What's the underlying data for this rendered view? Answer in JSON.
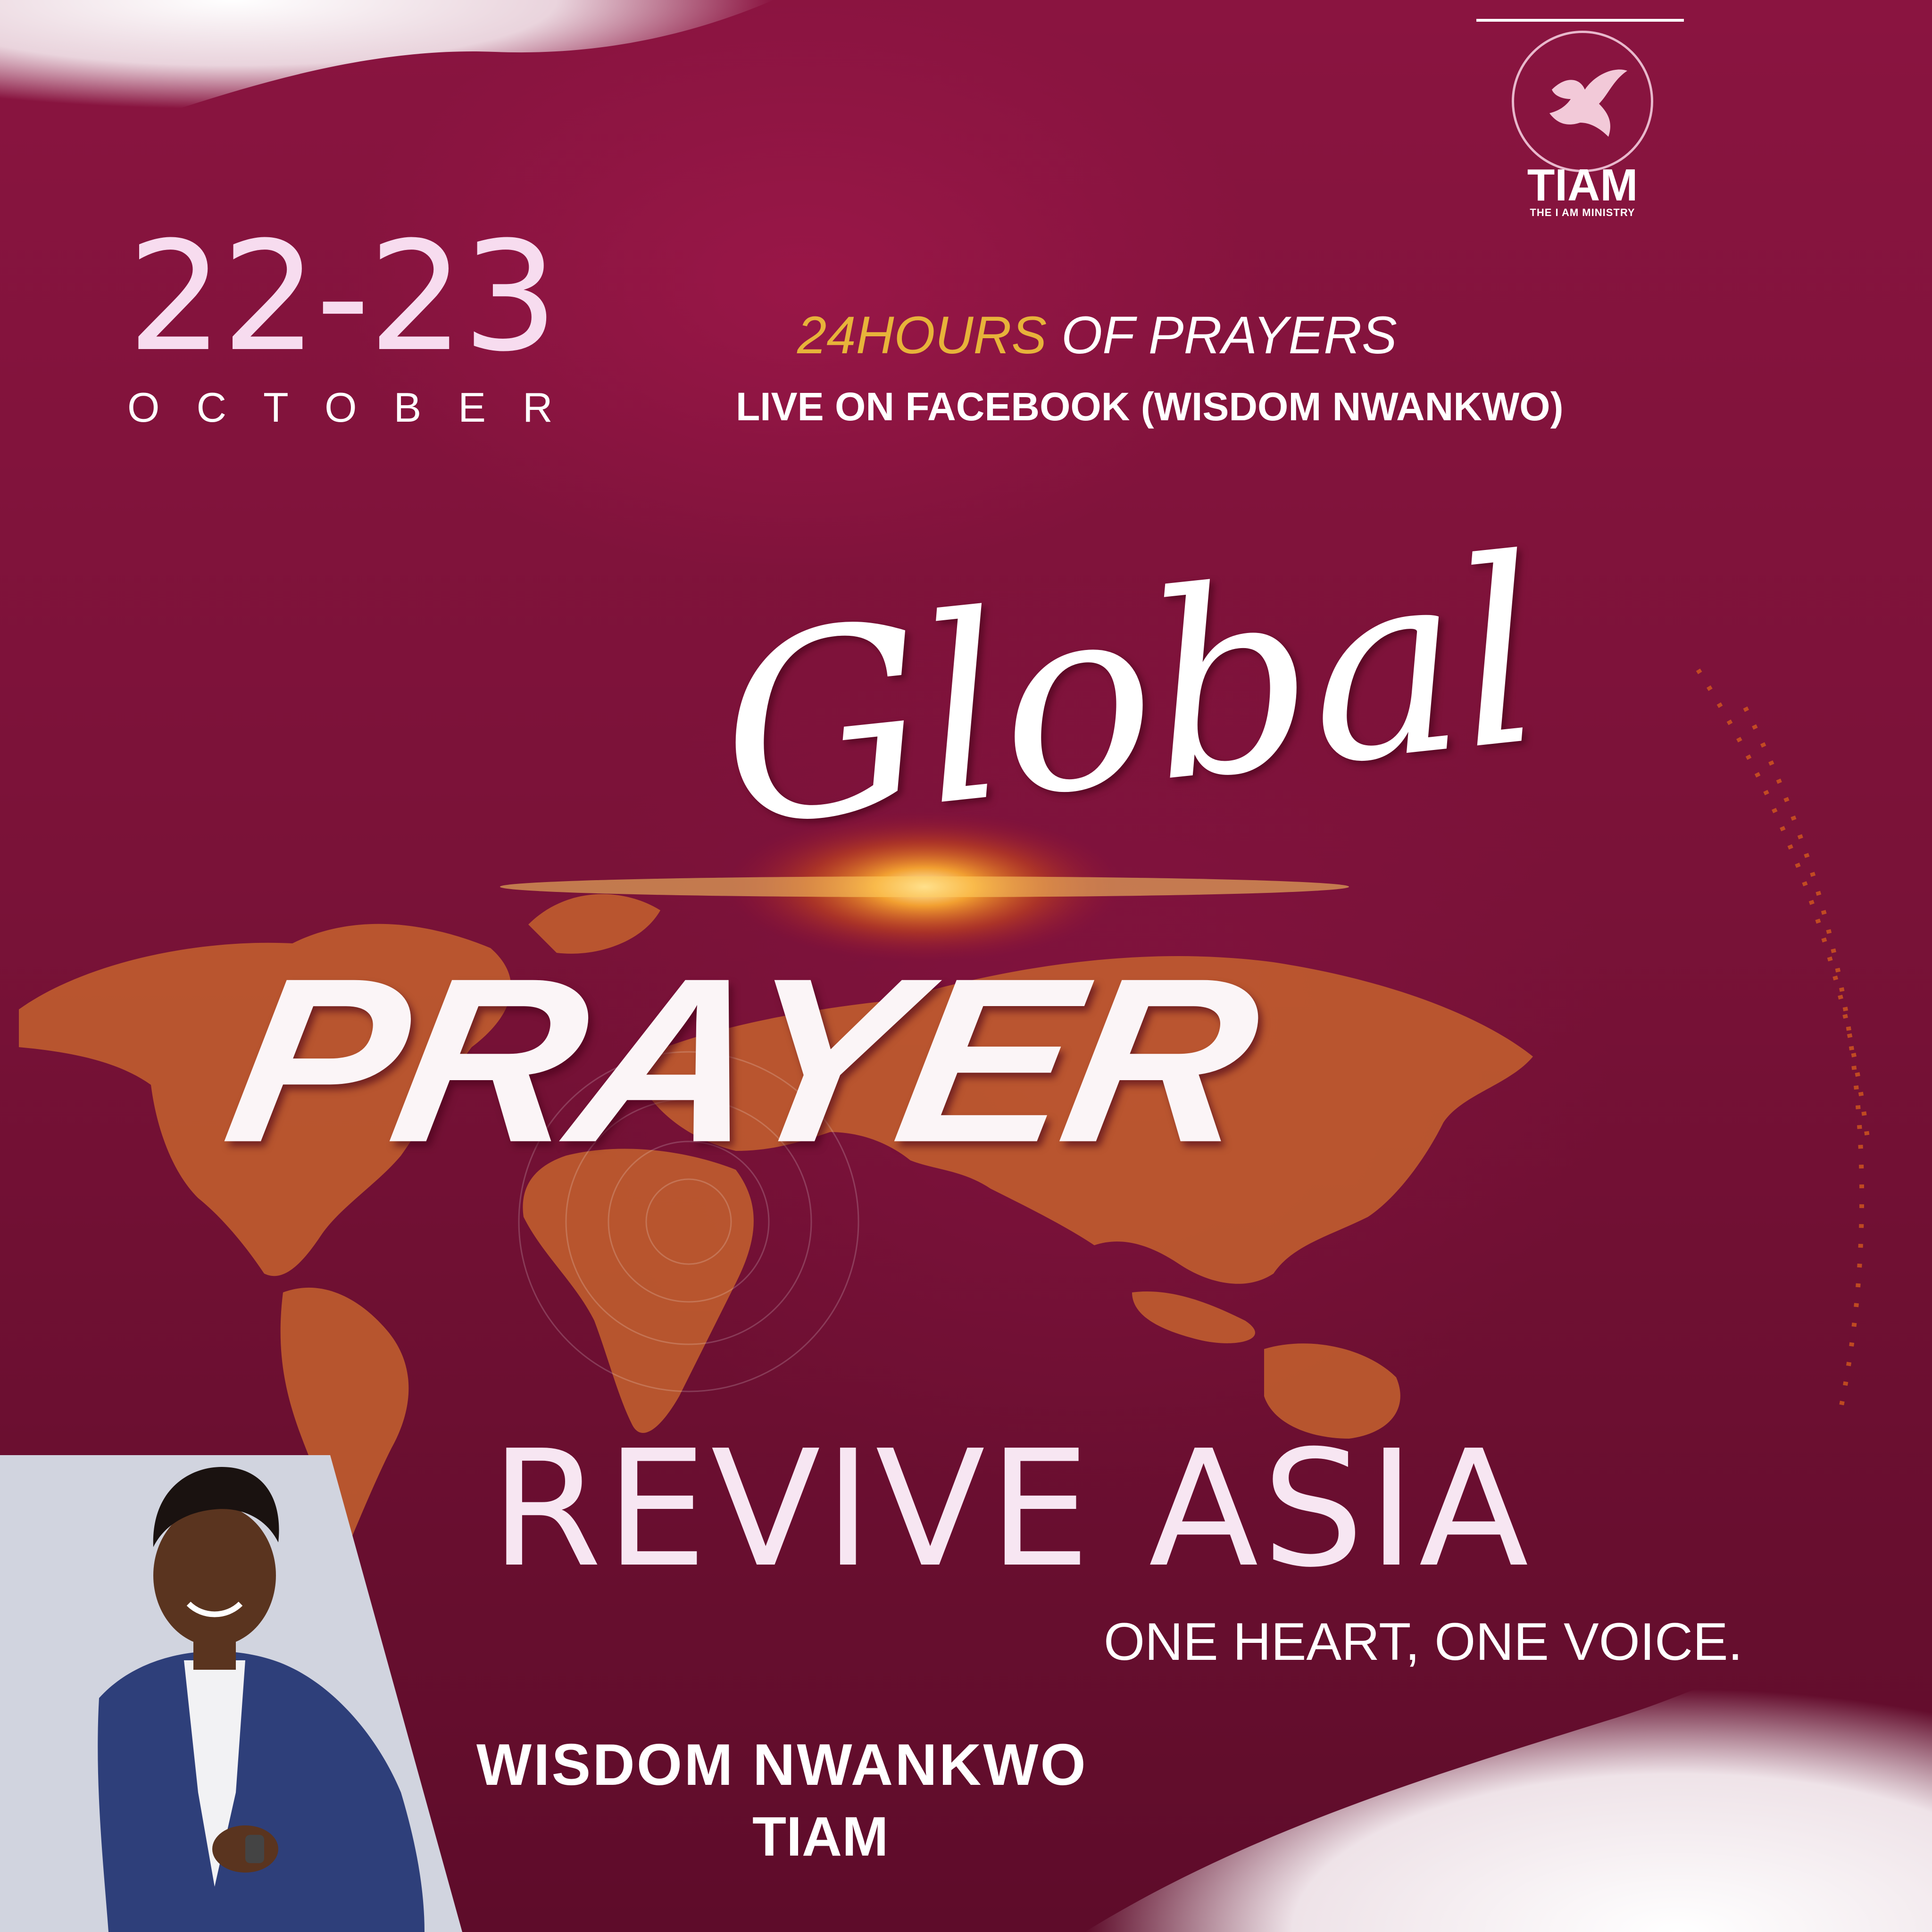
{
  "event": {
    "date_range": "22-23",
    "month": "OCTOBER",
    "hours_highlight": "24HOURS",
    "hours_rest": " OF PRAYERS",
    "live_info": "LIVE ON FACEBOOK (WISDOM NWANKWO)",
    "title_script": "Global",
    "title_main": "PRAYER",
    "theme": "REVIVE ASIA",
    "tagline": "ONE HEART, ONE VOICE."
  },
  "logo": {
    "name": "TIAM",
    "tagline": "THE I AM MINISTRY"
  },
  "speaker": {
    "name": "WISDOM NWANKWO",
    "org": "TIAM"
  },
  "colors": {
    "background": "#7a1238",
    "gold_accent": "#e7b33a",
    "map_orange": "#c4622e",
    "text_pink": "#f7dcef",
    "photo_bg": "#c9ccd8",
    "suit_blue": "#2e3f7a"
  }
}
